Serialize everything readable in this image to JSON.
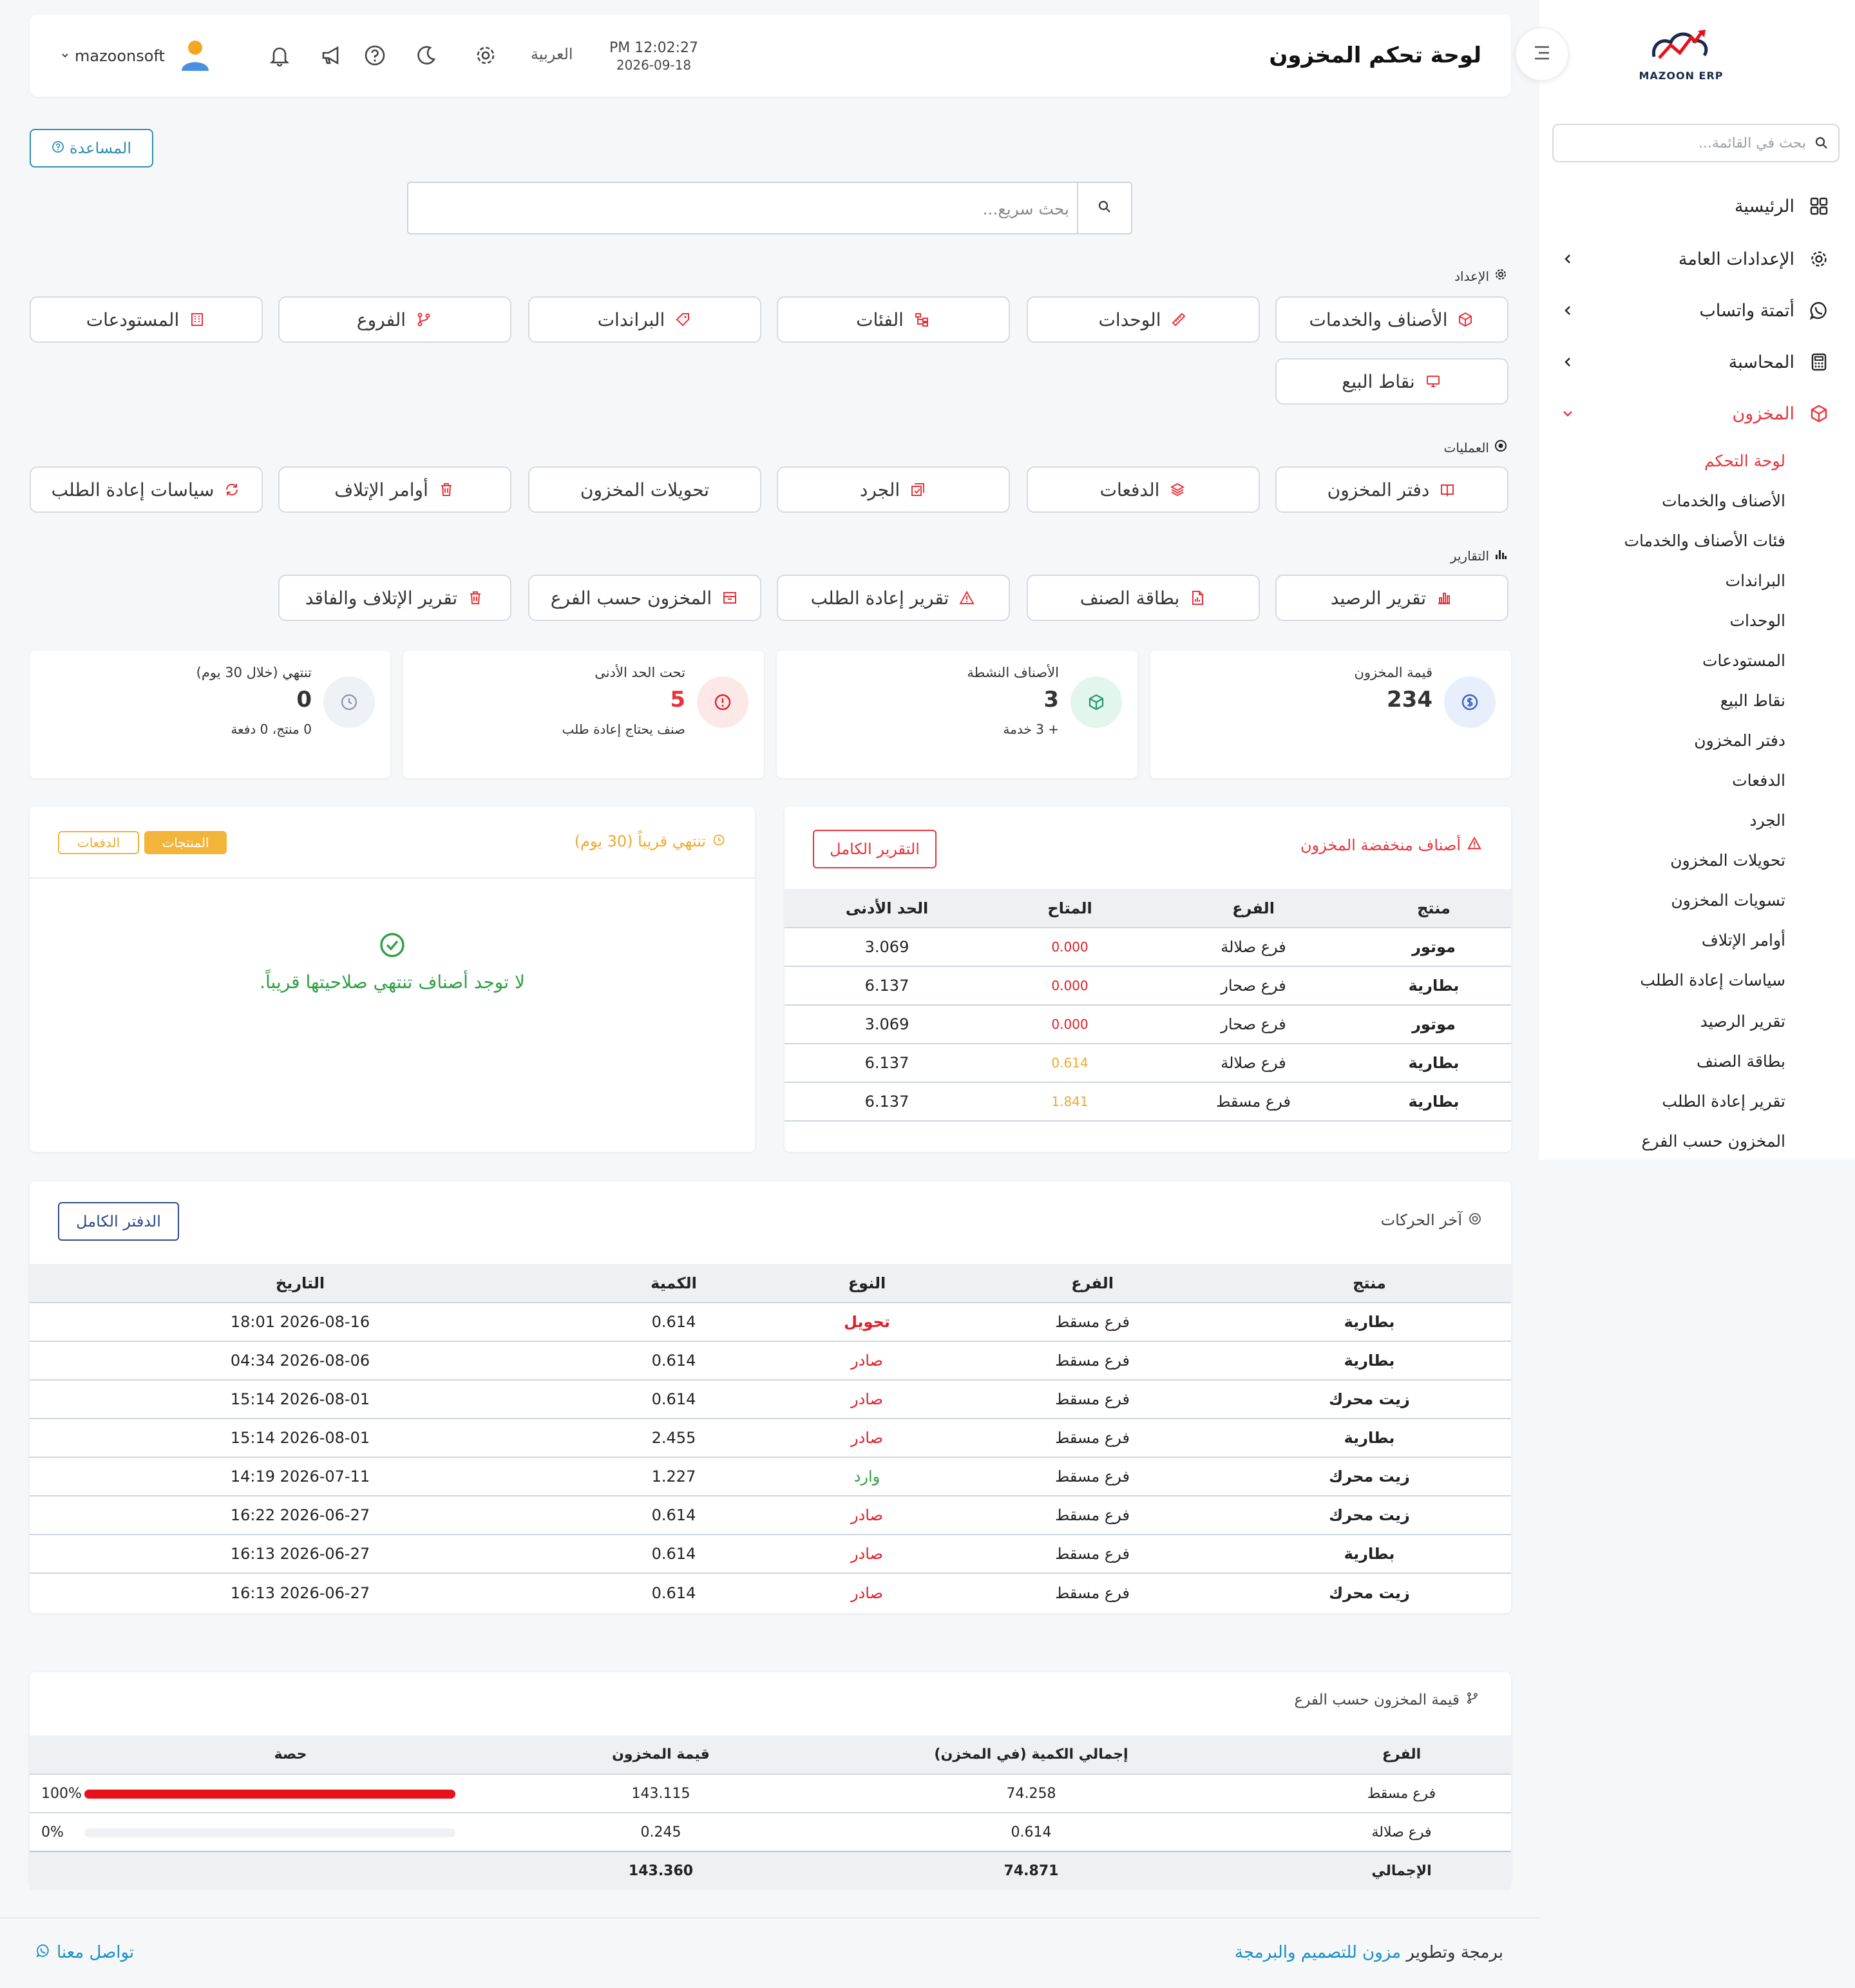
{
  "app": {
    "logo_text": "MAZOON ERP"
  },
  "sidebar": {
    "search_placeholder": "بحث في القائمة...",
    "main": [
      {
        "label": "الرئيسية",
        "icon": "grid-icon"
      },
      {
        "label": "الإعدادات العامة",
        "icon": "gear-icon"
      },
      {
        "label": "أتمتة واتساب",
        "icon": "whatsapp-icon"
      },
      {
        "label": "المحاسبة",
        "icon": "calculator-icon"
      },
      {
        "label": "المخزون",
        "icon": "box-icon"
      }
    ],
    "sub": [
      "لوحة التحكم",
      "الأصناف والخدمات",
      "فئات الأصناف والخدمات",
      "البراندات",
      "الوحدات",
      "المستودعات",
      "نقاط البيع",
      "دفتر المخزون",
      "الدفعات",
      "الجرد",
      "تحويلات المخزون",
      "تسويات المخزون",
      "أوامر الإتلاف",
      "سياسات إعادة الطلب",
      "تقرير الرصيد",
      "بطاقة الصنف",
      "تقرير إعادة الطلب",
      "المخزون حسب الفرع"
    ]
  },
  "header": {
    "title": "لوحة تحكم المخزون",
    "time": "PM 12:02:27",
    "date": "2026-09-18",
    "language": "العربية",
    "username": "mazoonsoft"
  },
  "help_label": "المساعدة",
  "quick_search_placeholder": "بحث سريع...",
  "sections": {
    "setup": "الإعداد",
    "operations": "العمليات",
    "reports": "التقارير"
  },
  "setup_tiles": [
    "الأصناف والخدمات",
    "الوحدات",
    "الفئات",
    "البراندات",
    "الفروع",
    "المستودعات",
    "نقاط البيع"
  ],
  "operations_tiles": [
    "دفتر المخزون",
    "الدفعات",
    "الجرد",
    "تحويلات المخزون",
    "أوامر الإتلاف",
    "سياسات إعادة الطلب"
  ],
  "reports_tiles": [
    "تقرير الرصيد",
    "بطاقة الصنف",
    "تقرير إعادة الطلب",
    "المخزون حسب الفرع",
    "تقرير الإتلاف والفاقد"
  ],
  "stats": [
    {
      "title": "قيمة المخزون",
      "value": "234",
      "sub": ""
    },
    {
      "title": "الأصناف النشطة",
      "value": "3",
      "sub": "+ 3 خدمة"
    },
    {
      "title": "تحت الحد الأدنى",
      "value": "5",
      "sub": "صنف يحتاج إعادة طلب"
    },
    {
      "title": "تنتهي (خلال 30 يوم)",
      "value": "0",
      "sub": "0 منتج، 0 دفعة"
    }
  ],
  "low_stock": {
    "title": "أصناف منخفضة المخزون",
    "button": "التقرير الكامل",
    "headers": [
      "منتج",
      "الفرع",
      "المتاح",
      "الحد الأدنى"
    ],
    "rows": [
      [
        "موتور",
        "فرع صلالة",
        "0.000",
        "3.069"
      ],
      [
        "بطارية",
        "فرع صحار",
        "0.000",
        "6.137"
      ],
      [
        "موتور",
        "فرع صحار",
        "0.000",
        "3.069"
      ],
      [
        "بطارية",
        "فرع صلالة",
        "0.614",
        "6.137"
      ],
      [
        "بطارية",
        "فرع مسقط",
        "1.841",
        "6.137"
      ]
    ]
  },
  "expiring": {
    "title": "تنتهي قريباً (30 يوم)",
    "tab_products": "المنتجات",
    "tab_batches": "الدفعات",
    "empty": "لا توجد أصناف تنتهي صلاحيتها قريباً."
  },
  "movements": {
    "title": "آخر الحركات",
    "button": "الدفتر الكامل",
    "headers": [
      "منتج",
      "الفرع",
      "النوع",
      "الكمية",
      "التاريخ"
    ],
    "rows": [
      [
        "بطارية",
        "فرع مسقط",
        "تحويل",
        "0.614",
        "2026-08-16 18:01"
      ],
      [
        "بطارية",
        "فرع مسقط",
        "صادر",
        "0.614",
        "2026-08-06 04:34"
      ],
      [
        "زيت محرك",
        "فرع مسقط",
        "صادر",
        "0.614",
        "2026-08-01 15:14"
      ],
      [
        "بطارية",
        "فرع مسقط",
        "صادر",
        "2.455",
        "2026-08-01 15:14"
      ],
      [
        "زيت محرك",
        "فرع مسقط",
        "وارد",
        "1.227",
        "2026-07-11 14:19"
      ],
      [
        "زيت محرك",
        "فرع مسقط",
        "صادر",
        "0.614",
        "2026-06-27 16:22"
      ],
      [
        "بطارية",
        "فرع مسقط",
        "صادر",
        "0.614",
        "2026-06-27 16:13"
      ],
      [
        "زيت محرك",
        "فرع مسقط",
        "صادر",
        "0.614",
        "2026-06-27 16:13"
      ]
    ]
  },
  "by_branch": {
    "title": "قيمة المخزون حسب الفرع",
    "headers": [
      "الفرع",
      "إجمالي الكمية (في المخزن)",
      "قيمة المخزون",
      "حصة"
    ],
    "rows": [
      {
        "branch": "فرع مسقط",
        "qty": "74.258",
        "value": "143.115",
        "share_label": "100%",
        "share": 100
      },
      {
        "branch": "فرع صلالة",
        "qty": "0.614",
        "value": "0.245",
        "share_label": "0%",
        "share": 0
      }
    ],
    "total": {
      "label": "الإجمالي",
      "qty": "74.871",
      "value": "143.360"
    }
  },
  "footer": {
    "contact": "تواصل معنا",
    "credit_prefix": "برمجة وتطوير",
    "credit_brand": "مزون للتصميم والبرمجة"
  },
  "colors": {
    "accent_red": "#e8333a",
    "help_blue": "#2e8fb0",
    "amber": "#f0a92e",
    "green": "#2ea043"
  }
}
